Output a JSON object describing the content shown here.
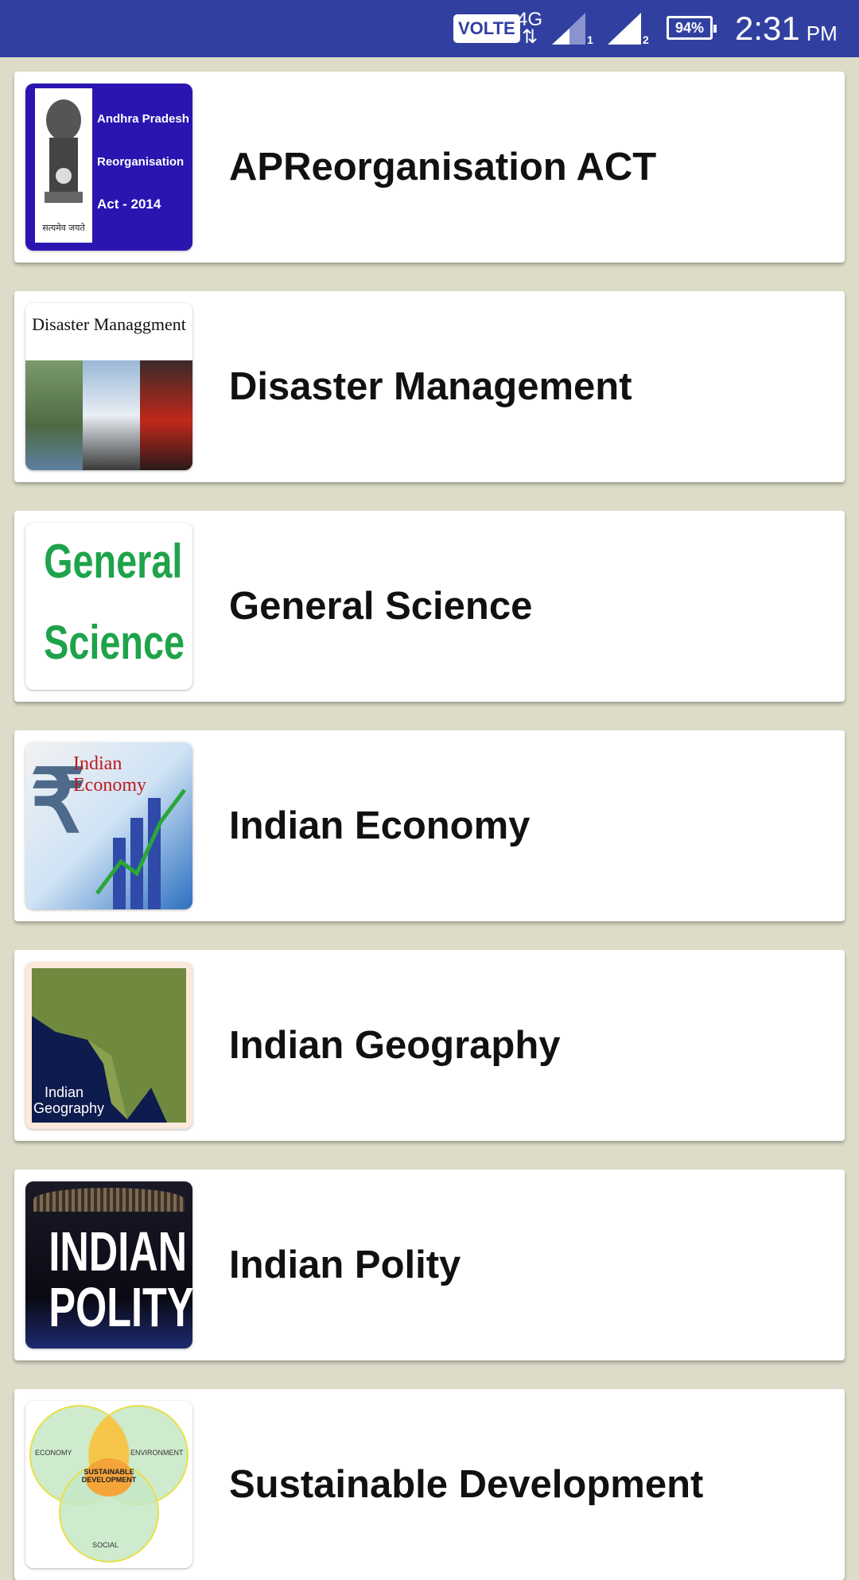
{
  "status_bar": {
    "volte": "VOLTE",
    "network": "4G",
    "network_arrows": "⇅",
    "sim1": "1",
    "sim2": "2",
    "battery": "94%",
    "time": "2:31",
    "ampm": "PM"
  },
  "items": [
    {
      "title": "APReorganisation ACT",
      "thumb_lines": [
        "Andhra Pradesh",
        "Reorganisation",
        "Act - 2014"
      ],
      "thumb_caption": "सत्यमेव जयते"
    },
    {
      "title": "Disaster Management",
      "thumb_heading": "Disaster Managgment"
    },
    {
      "title": "General Science",
      "thumb_lines": [
        "General",
        "Science"
      ]
    },
    {
      "title": "Indian Economy",
      "thumb_heading": "Indian Economy"
    },
    {
      "title": "Indian Geography",
      "thumb_lines": [
        "Indian",
        "Geography"
      ]
    },
    {
      "title": "Indian Polity",
      "thumb_lines": [
        "INDIAN",
        "POLITY"
      ]
    },
    {
      "title": "Sustainable Development",
      "thumb_labels": [
        "ECONOMY",
        "ENVIRONMENT",
        "SUSTAINABLE DEVELOPMENT",
        "SOCIAL"
      ]
    }
  ],
  "colors": {
    "status_bar": "#3140a0",
    "background": "#dcdcc8",
    "card": "#ffffff"
  }
}
